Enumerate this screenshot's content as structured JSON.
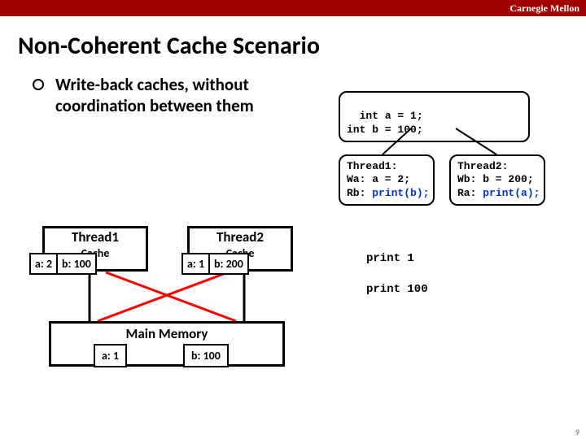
{
  "header": {
    "brand": "Carnegie Mellon"
  },
  "title": "Non-Coherent Cache Scenario",
  "bullet": "Write-back caches, without coordination between them",
  "shared_code": "int a = 1;\nint b = 100;",
  "thread1_code": {
    "name": "Thread1:",
    "l1": "Wa: a = 2;",
    "l2a": "Rb: ",
    "l2b": "print(b);"
  },
  "thread2_code": {
    "name": "Thread2:",
    "l1": "Wb: b = 200;",
    "l2a": "Ra: ",
    "l2b": "print(a);"
  },
  "cache1": {
    "title": "Thread1",
    "sub": "Cache",
    "a": "a: 2",
    "b": "b: 100"
  },
  "cache2": {
    "title": "Thread2",
    "sub": "Cache",
    "a": "a: 1",
    "b": "b: 200"
  },
  "memory": {
    "title": "Main Memory",
    "a": "a: 1",
    "b": "b: 100"
  },
  "output": {
    "p1": "print 1",
    "p2": "print 100"
  },
  "pagenum": "9"
}
